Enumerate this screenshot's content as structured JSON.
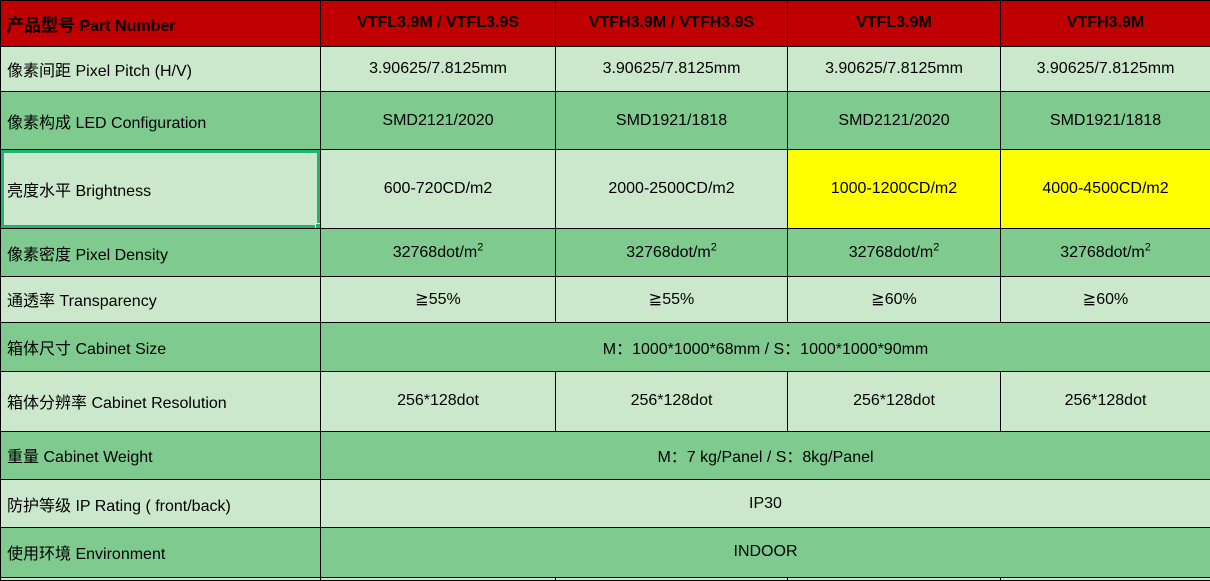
{
  "colors": {
    "header_bg": "#c00000",
    "header_text": "#ffffff",
    "row_light": "#cce8cc",
    "row_mid": "#7fcb8f",
    "highlight_yellow": "#ffff00",
    "accent_red": "#ff0000",
    "active_cell_border": "#21b573"
  },
  "table": {
    "header": {
      "label_cn": "产品型号",
      "label_en": "Part Number",
      "columns": [
        "VTFL3.9M / VTFL3.9S",
        "VTFH3.9M / VTFH3.9S",
        "VTFL3.9M",
        "VTFH3.9M"
      ]
    },
    "rows": [
      {
        "label_cn": "像素间距",
        "label_en": "Pixel Pitch (H/V)",
        "merged": false,
        "values": [
          "3.90625/7.8125mm",
          "3.90625/7.8125mm",
          "3.90625/7.8125mm",
          "3.90625/7.8125mm"
        ]
      },
      {
        "label_cn": "像素构成",
        "label_en": "LED Configuration",
        "merged": false,
        "values": [
          "SMD2121/2020",
          "SMD1921/1818",
          "SMD2121/2020",
          "SMD1921/1818"
        ]
      },
      {
        "label_cn": "亮度水平",
        "label_en": "Brightness",
        "merged": false,
        "values": [
          "600-720CD/m2",
          "2000-2500CD/m2",
          "1000-1200CD/m2",
          "4000-4500CD/m2"
        ]
      },
      {
        "label_cn": "像素密度",
        "label_en": "Pixel Density",
        "merged": false,
        "value_base": "32768dot/m",
        "value_sup": "2"
      },
      {
        "label_cn": "通透率",
        "label_en": "Transparency",
        "merged": false,
        "values": [
          "≧55%",
          "≧55%",
          "≧60%",
          "≧60%"
        ]
      },
      {
        "label_cn": "箱体尺寸",
        "label_en": "Cabinet Size",
        "merged": true,
        "merged_value": "M：1000*1000*68mm  /  S：1000*1000*90mm"
      },
      {
        "label_cn": "箱体分辨率",
        "label_en": "Cabinet Resolution",
        "merged": false,
        "values": [
          "256*128dot",
          "256*128dot",
          "256*128dot",
          "256*128dot"
        ]
      },
      {
        "label_cn": "重量",
        "label_en": " Cabinet Weight",
        "merged": true,
        "merged_value": "M：7 kg/Panel  /  S：8kg/Panel"
      },
      {
        "label_cn": "防护等级",
        "label_en": "IP Rating ( front/back)",
        "merged": true,
        "merged_value": "IP30"
      },
      {
        "label_cn": "使用环境",
        "label_en": "Environment",
        "merged": true,
        "merged_value": "INDOOR"
      }
    ]
  }
}
